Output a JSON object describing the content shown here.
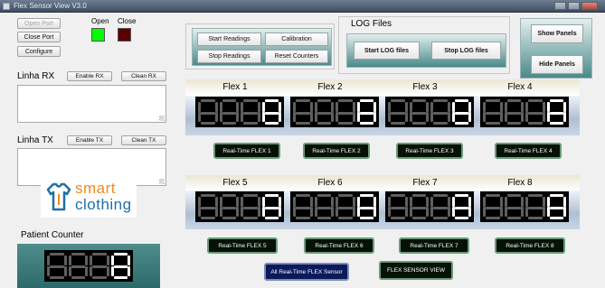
{
  "window": {
    "title": "Flex Sensor View V3.0"
  },
  "port": {
    "open_port": "Open Port",
    "close_port": "Close Port",
    "configure": "Configure",
    "open_led_label": "Open",
    "close_led_label": "Close",
    "led_colors": {
      "open": "#00ff00",
      "close": "#5a0000"
    }
  },
  "rx": {
    "label": "Linha RX",
    "enable": "Enable RX",
    "clean": "Clean RX",
    "value": ""
  },
  "tx": {
    "label": "Linha TX",
    "enable": "Enable TX",
    "clean": "Clean TX",
    "value": ""
  },
  "logo": {
    "line1": "smart",
    "line2": "clothing",
    "icon": "shirt-icon"
  },
  "patient_counter": {
    "label": "Patient Counter",
    "display": "8888"
  },
  "controls": {
    "start_readings": "Start Readings",
    "calibration": "Calibration",
    "stop_readings": "Stop Readings",
    "reset_counters": "Reset Counters"
  },
  "log": {
    "title": "LOG Files",
    "start": "Start LOG files",
    "stop": "Stop LOG files"
  },
  "panels": {
    "show": "Show Panels",
    "hide": "Hide Panels"
  },
  "flex_sensors": [
    {
      "name": "Flex 1",
      "display": "8888",
      "button": "Real-Time FLEX 1"
    },
    {
      "name": "Flex 2",
      "display": "8888",
      "button": "Real-Time FLEX 2"
    },
    {
      "name": "Flex 3",
      "display": "8888",
      "button": "Real-Time FLEX 3"
    },
    {
      "name": "Flex 4",
      "display": "8888",
      "button": "Real-Time FLEX 4"
    },
    {
      "name": "Flex 5",
      "display": "8888",
      "button": "Real-Time FLEX 5"
    },
    {
      "name": "Flex 6",
      "display": "8888",
      "button": "Real-Time FLEX 6"
    },
    {
      "name": "Flex 7",
      "display": "8888",
      "button": "Real-Time FLEX 7"
    },
    {
      "name": "Flex 8",
      "display": "8888",
      "button": "Real-Time FLEX 8"
    }
  ],
  "bottom": {
    "all_sensors": "All Real-Time FLEX Sensor",
    "view": "FLEX SENSOR VIEW"
  }
}
